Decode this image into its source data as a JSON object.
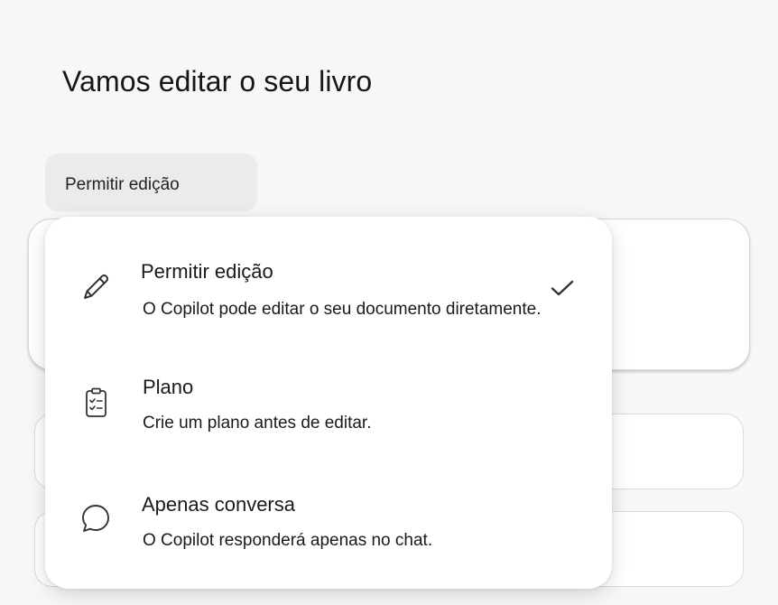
{
  "page": {
    "title": "Vamos editar o seu livro"
  },
  "mode_selector": {
    "current_label": "Permitir edição"
  },
  "menu": {
    "items": [
      {
        "label": "Permitir edição",
        "description": "O Copilot pode editar o seu documento diretamente.",
        "icon": "pencil-icon",
        "selected": true
      },
      {
        "label": "Plano",
        "description": "Crie um plano antes de editar.",
        "icon": "clipboard-checklist-icon",
        "selected": false
      },
      {
        "label": "Apenas conversa",
        "description": "O Copilot responderá apenas no chat.",
        "icon": "chat-bubble-icon",
        "selected": false
      }
    ]
  },
  "colors": {
    "background": "#f7f7f7",
    "surface": "#ffffff",
    "button_bg": "#ebebeb",
    "text": "#1a1a1a",
    "icon": "#333333"
  }
}
